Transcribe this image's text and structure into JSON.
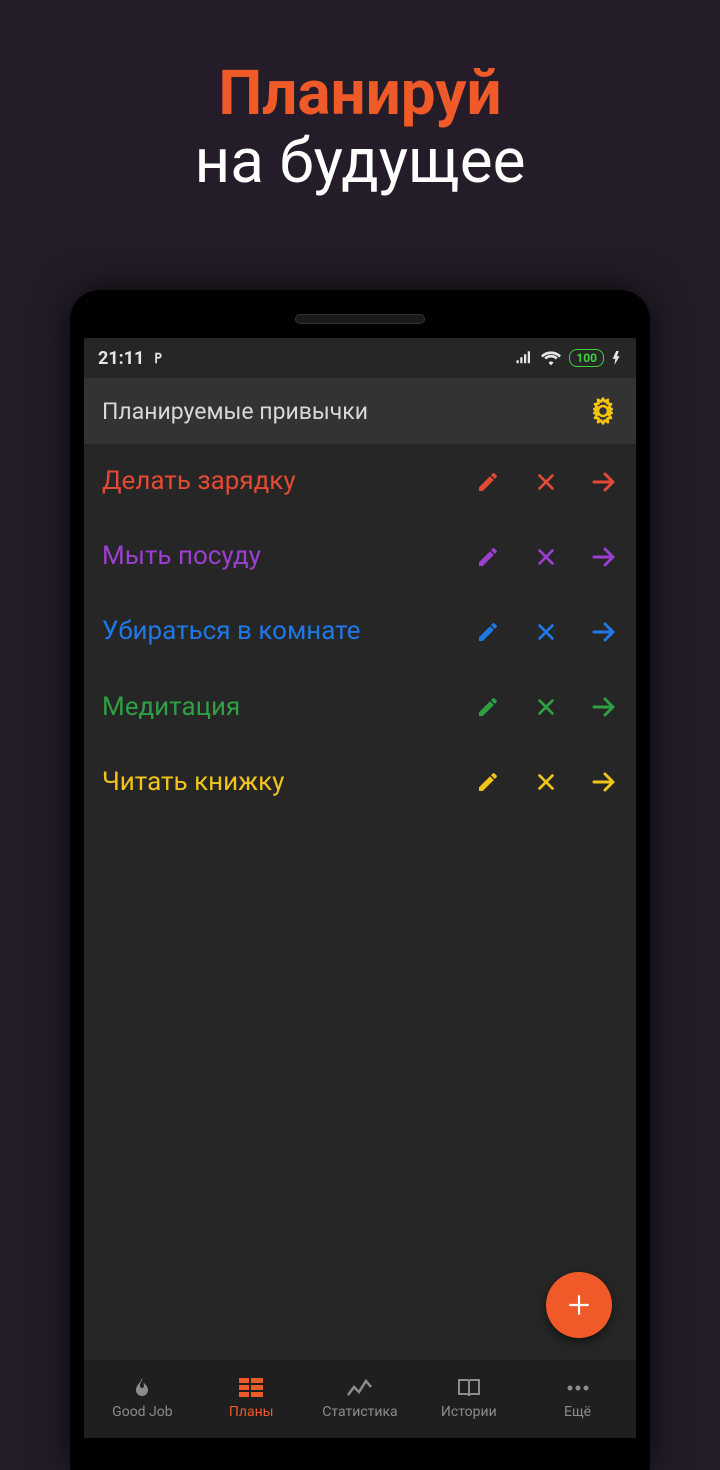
{
  "promo": {
    "line1": "Планируй",
    "line2": "на будущее"
  },
  "status": {
    "time": "21:11",
    "battery": "100"
  },
  "appbar": {
    "title": "Планируемые привычки"
  },
  "habits": [
    {
      "label": "Делать зарядку",
      "color": "#e24a33"
    },
    {
      "label": "Мыть посуду",
      "color": "#9b3fd1"
    },
    {
      "label": "Убираться в комнате",
      "color": "#1e78e6"
    },
    {
      "label": "Медитация",
      "color": "#2ea043"
    },
    {
      "label": "Читать книжку",
      "color": "#f0c419"
    }
  ],
  "nav": {
    "items": [
      {
        "label": "Good Job"
      },
      {
        "label": "Планы"
      },
      {
        "label": "Статистика"
      },
      {
        "label": "Истории"
      },
      {
        "label": "Ещё"
      }
    ],
    "active_index": 1
  },
  "colors": {
    "accent": "#f05a28"
  }
}
